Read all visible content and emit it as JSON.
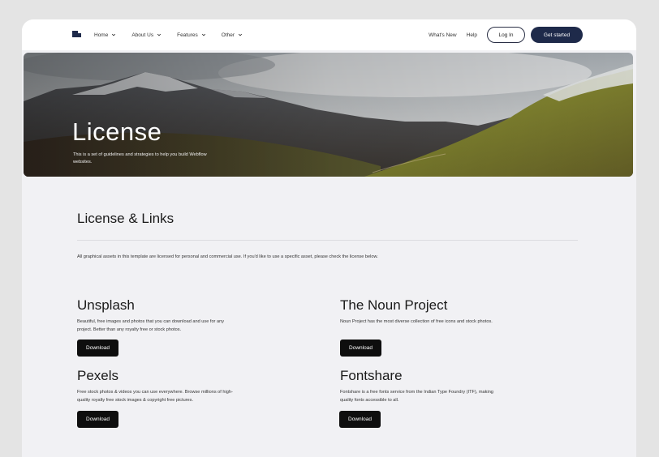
{
  "nav": {
    "logo_icon": "brand-logo-icon",
    "menu": [
      {
        "label": "Home",
        "icon": "chevron-down-icon"
      },
      {
        "label": "About Us",
        "icon": "chevron-down-icon"
      },
      {
        "label": "Features",
        "icon": "chevron-down-icon"
      },
      {
        "label": "Other",
        "icon": "chevron-down-icon"
      }
    ],
    "whats_new": "What's New",
    "help": "Help",
    "login": "Log In",
    "get_started": "Get started"
  },
  "hero": {
    "title": "License",
    "subtitle": "This is a set of guidelines and strategies to help you build Webflow websites."
  },
  "main": {
    "section_title": "License & Links",
    "intro": "All graphical assets in this template are licensed for personal and commercial use. If you'd like to use a specific asset, please check the license below.",
    "resources": [
      {
        "title": "Unsplash",
        "description": "Beautiful, free images and photos that you can download and use for any project. Better than any royalty free or stock photos.",
        "button": "Download"
      },
      {
        "title": "The Noun Project",
        "description": "Noun Project has the most diverse collection of free icons and stock photos.",
        "button": "Download"
      },
      {
        "title": "Pexels",
        "description": "Free stock photos & videos you can use everywhere. Browse millions of high-quality royalty free stock images & copyright free pictures.",
        "button": "Download"
      },
      {
        "title": "Fontshare",
        "description": "Fontshare is a free fonts service from the Indian Type Foundry (ITF), making quality fonts accessible to all.",
        "button": "Download"
      }
    ]
  },
  "colors": {
    "brand_navy": "#1e2a4a",
    "page_bg": "#f1f1f4",
    "button_dark": "#0e0e0e"
  }
}
